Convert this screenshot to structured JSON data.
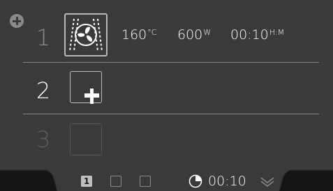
{
  "stages": [
    {
      "number": "1",
      "mode_icon": "convection-fan-icon",
      "temperature": {
        "value": "160",
        "unit": "°C"
      },
      "power": {
        "value": "600",
        "unit": "W"
      },
      "time": {
        "value": "00:10",
        "unit": "H:M"
      }
    },
    {
      "number": "2",
      "action_icon": "add-stage-icon"
    },
    {
      "number": "3"
    }
  ],
  "footer": {
    "pages": [
      "1",
      "",
      ""
    ],
    "active_page": "1",
    "total_time": "00:10",
    "timer_icon": "timer-icon",
    "expand_icon": "chevron-down-icon"
  },
  "icons": {
    "corner_add": "add-circle-icon"
  },
  "colors": {
    "background": "#3a3a3a",
    "bar": "#151515",
    "text": "#ffffff",
    "muted": "#8c8c8c",
    "disabled": "#5e5e5e"
  }
}
